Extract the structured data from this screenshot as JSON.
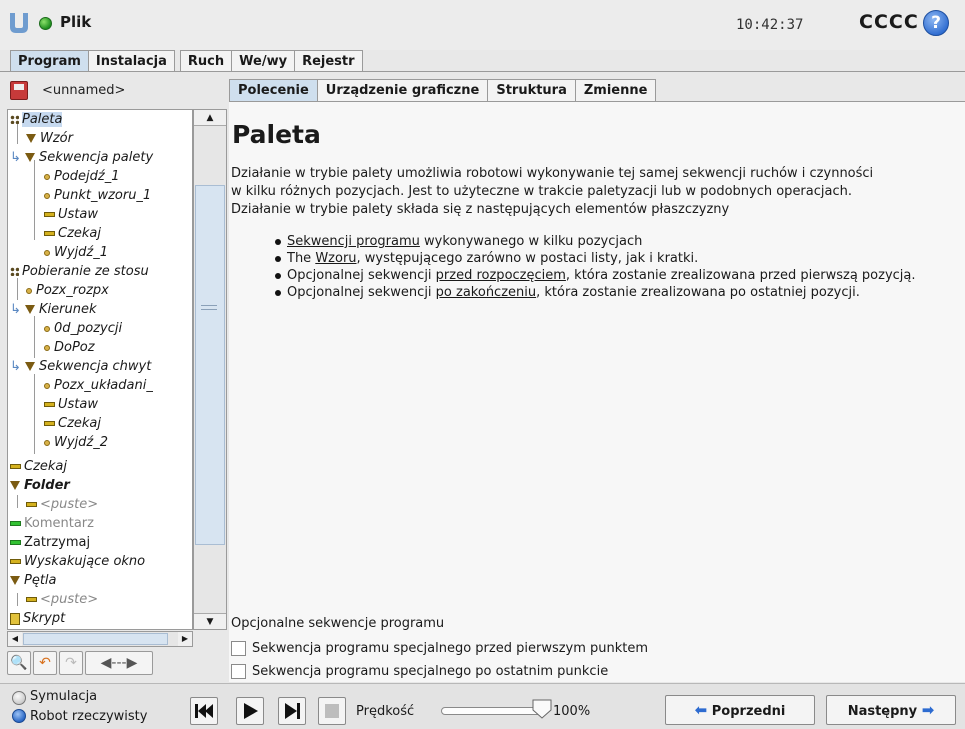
{
  "header": {
    "file_menu": "Plik",
    "clock": "10:42:37",
    "robot_name": "CCCC",
    "help": "?"
  },
  "main_tabs": [
    "Program",
    "Instalacja",
    "Ruch",
    "We/wy",
    "Rejestr"
  ],
  "program": {
    "name": "<unnamed>"
  },
  "tree": [
    "Paleta",
    "Wzór",
    "Sekwencja palety",
    "Podejdź_1",
    "Punkt_wzoru_1",
    "Ustaw",
    "Czekaj",
    "Wyjdź_1",
    "Pobieranie ze stosu",
    "Pozx_rozpx",
    "Kierunek",
    "0d_pozycji",
    "DoPoz",
    "Sekwencja chwyt",
    "Pozx_układani_",
    "Ustaw",
    "Czekaj",
    "Wyjdź_2",
    "Czekaj",
    "Folder",
    "<puste>",
    "Komentarz",
    "Zatrzymaj",
    "Wyskakujące okno",
    "Pętla",
    "<puste>",
    "Skrypt"
  ],
  "sub_tabs": [
    "Polecenie",
    "Urządzenie graficzne",
    "Struktura",
    "Zmienne"
  ],
  "content": {
    "title": "Paleta",
    "intro_1": "Działanie w trybie palety umożliwia robotowi wykonywanie tej samej sekwencji ruchów i czynności",
    "intro_2": "w kilku różnych pozycjach. Jest to użyteczne w trakcie paletyzacji lub w podobnych operacjach.",
    "intro_3": "Działanie w trybie palety składa się z następujących elementów płaszczyzny",
    "b1_link": "Sekwencji programu",
    "b1_rest": " wykonywanego w kilku pozycjach",
    "b2_pre": "The ",
    "b2_link": "Wzoru",
    "b2_rest": ", występującego zarówno w postaci listy, jak i kratki.",
    "b3_pre": "Opcjonalnej sekwencji ",
    "b3_link": "przed rozpoczęciem",
    "b3_rest": ", która zostanie zrealizowana przed pierwszą pozycją.",
    "b4_pre": "Opcjonalnej sekwencji ",
    "b4_link": "po zakończeniu",
    "b4_rest": ", która zostanie zrealizowana po ostatniej pozycji.",
    "optional_label": "Opcjonalne sekwencje programu",
    "opt_before": "Sekwencja programu specjalnego przed pierwszym punktem",
    "opt_after": "Sekwencja programu specjalnego po ostatnim punkcie"
  },
  "bottom": {
    "sim_label": "Symulacja",
    "real_label": "Robot rzeczywisty",
    "speed_label": "Prędkość",
    "speed_value": "100%",
    "speed_fraction": 1.0,
    "prev": "Poprzedni",
    "next": "Następny"
  }
}
